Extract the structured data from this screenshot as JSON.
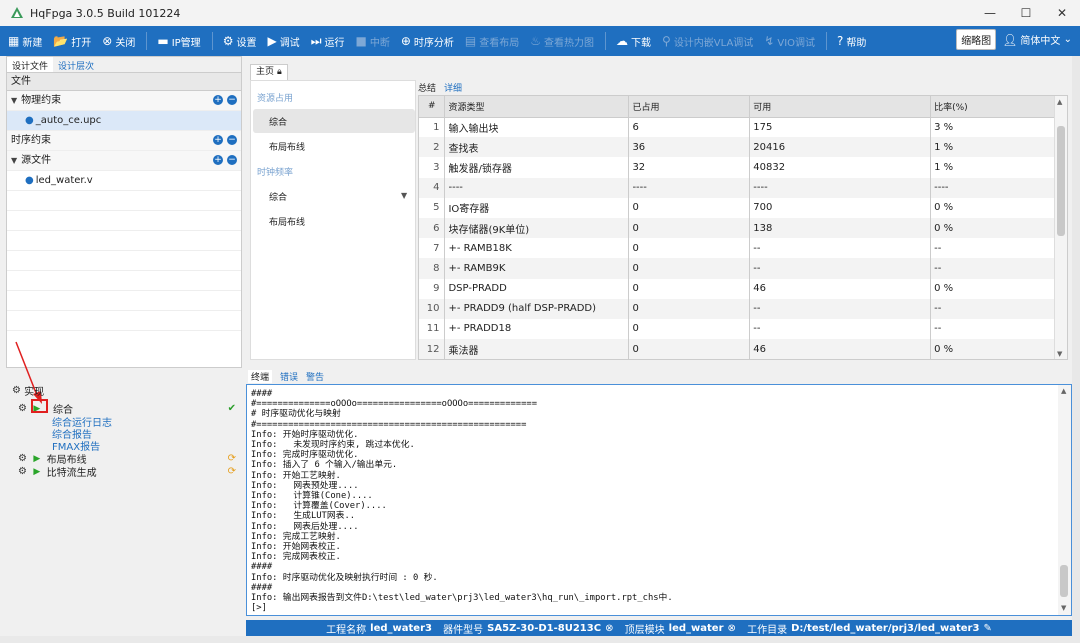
{
  "window": {
    "title": "HqFpga 3.0.5 Build 101224",
    "controls": [
      "—",
      "☐",
      "✕"
    ]
  },
  "toolbar": {
    "items": [
      {
        "icon": "▦",
        "label": "新建",
        "disabled": false
      },
      {
        "icon": "📂",
        "label": "打开",
        "disabled": false
      },
      {
        "icon": "⊗",
        "label": "关闭",
        "disabled": false
      },
      {
        "icon": "▬",
        "label": "IP管理",
        "disabled": false
      },
      {
        "icon": "⚙",
        "label": "设置",
        "disabled": false
      },
      {
        "icon": "▶",
        "label": "调试",
        "disabled": false
      },
      {
        "icon": "⏭",
        "label": "运行",
        "disabled": false
      },
      {
        "icon": "■",
        "label": "中断",
        "disabled": true
      },
      {
        "icon": "⊕",
        "label": "时序分析",
        "disabled": false
      },
      {
        "icon": "▤",
        "label": "查看布局",
        "disabled": true
      },
      {
        "icon": "♨",
        "label": "查看热力图",
        "disabled": true
      },
      {
        "icon": "☁",
        "label": "下载",
        "disabled": false
      },
      {
        "icon": "⚲",
        "label": "设计内嵌VLA调试",
        "disabled": true
      },
      {
        "icon": "↯",
        "label": "VIO调试",
        "disabled": true
      },
      {
        "icon": "?",
        "label": "帮助",
        "disabled": false
      }
    ],
    "thumbnail": "缩略图",
    "language": "简体中文"
  },
  "left": {
    "tabs": [
      "设计文件",
      "设计层次"
    ],
    "header": "文件",
    "groups": [
      {
        "label": "物理约束",
        "children": [
          "_auto_ce.upc"
        ]
      },
      {
        "label": "时序约束",
        "children": []
      },
      {
        "label": "源文件",
        "children": [
          "led_water.v"
        ]
      }
    ]
  },
  "impl": {
    "title": "实现",
    "steps": [
      {
        "label": "综合",
        "status": "✔",
        "sub": [
          "综合运行日志",
          "综合报告",
          "FMAX报告"
        ]
      },
      {
        "label": "布局布线",
        "status": "⟳"
      },
      {
        "label": "比特流生成",
        "status": "⟳"
      }
    ]
  },
  "main": {
    "tab": "主页",
    "nav": {
      "sec1": "资源占用",
      "items1": [
        "综合",
        "布局布线"
      ],
      "sec2": "时钟频率",
      "items2": [
        "综合",
        "布局布线"
      ]
    },
    "subtabs": [
      "总结",
      "详细"
    ],
    "table": {
      "headers": [
        "#",
        "资源类型",
        "已占用",
        "可用",
        "比率(%)"
      ],
      "rows": [
        [
          "1",
          "输入输出块",
          "6",
          "175",
          "3 %"
        ],
        [
          "2",
          "查找表",
          "36",
          "20416",
          "1 %"
        ],
        [
          "3",
          "触发器/锁存器",
          "32",
          "40832",
          "1 %"
        ],
        [
          "4",
          "----",
          "----",
          "----",
          "----"
        ],
        [
          "5",
          "IO寄存器",
          "0",
          "700",
          "0 %"
        ],
        [
          "6",
          "块存储器(9K单位)",
          "0",
          "138",
          "0 %"
        ],
        [
          "7",
          "+- RAMB18K",
          "0",
          "--",
          "--"
        ],
        [
          "8",
          "+- RAMB9K",
          "0",
          "--",
          "--"
        ],
        [
          "9",
          "DSP-PRADD",
          "0",
          "46",
          "0 %"
        ],
        [
          "10",
          "+- PRADD9 (half DSP-PRADD)",
          "0",
          "--",
          "--"
        ],
        [
          "11",
          "+- PRADD18",
          "0",
          "--",
          "--"
        ],
        [
          "12",
          "乘法器",
          "0",
          "46",
          "0 %"
        ]
      ]
    }
  },
  "log": {
    "tabs": [
      "终端",
      "错误",
      "警告"
    ],
    "lines": [
      "####",
      "#==============oOOOo================oOOOo=============",
      "# 时序驱动优化与映射",
      "#===================================================",
      "Info: 开始时序驱动优化.",
      "Info:   未发现时序约束, 跳过本优化.",
      "Info: 完成时序驱动优化.",
      "Info: 插入了 6 个输入/输出单元.",
      "Info: 开始工艺映射.",
      "Info:   网表预处理....",
      "Info:   计算锥(Cone)....",
      "Info:   计算覆盖(Cover)....",
      "Info:   生成LUT网表..",
      "Info:   网表后处理....",
      "Info: 完成工艺映射.",
      "Info: 开始网表校正.",
      "Info: 完成网表校正.",
      "####",
      "Info: 时序驱动优化及映射执行时间 : 0 秒.",
      "####",
      "Info: 输出网表报告到文件D:\\test\\led_water\\prj3\\led_water3\\hq_run\\_import.rpt_chs中.",
      "[>]"
    ]
  },
  "status": {
    "proj_label": "工程名称",
    "proj": "led_water3",
    "dev_label": "器件型号",
    "dev": "SA5Z-30-D1-8U213C",
    "top_label": "顶层模块",
    "top": "led_water",
    "dir_label": "工作目录",
    "dir": "D:/test/led_water/prj3/led_water3"
  },
  "colors": {
    "accent": "#1f6fc0",
    "highlight": "#e02020",
    "ok": "#2a9d2a"
  }
}
